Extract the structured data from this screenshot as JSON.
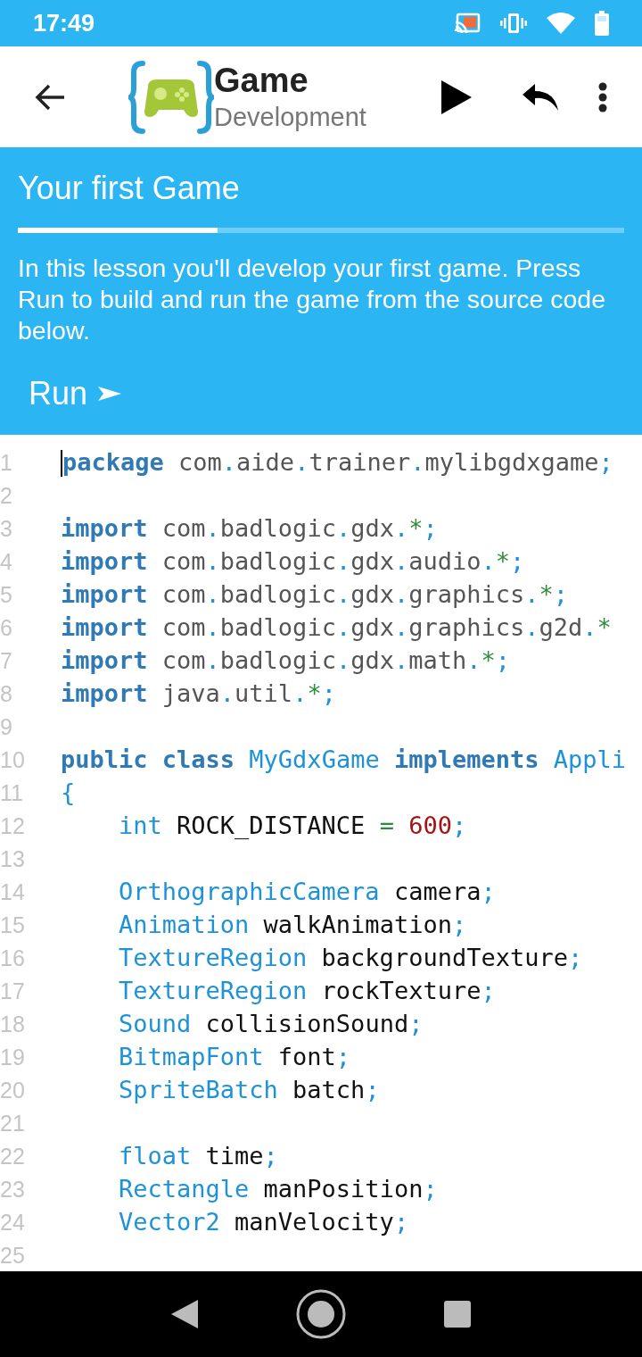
{
  "status_bar": {
    "time": "17:49"
  },
  "app_bar": {
    "title": "Game",
    "subtitle": "Development"
  },
  "lesson": {
    "title": "Your first Game",
    "progress": {
      "level": 0.33
    },
    "description": "In this lesson you'll develop your first game. Press Run to build and run the game from the source code below.",
    "run_button": "Run"
  },
  "editor": {
    "lines": [
      {
        "number": "1",
        "cursor": true,
        "tokens": [
          {
            "kind": "keyword",
            "t": "package"
          },
          {
            "kind": "package",
            "t": " com"
          },
          {
            "kind": "punct",
            "t": "."
          },
          {
            "kind": "package",
            "t": "aide"
          },
          {
            "kind": "punct",
            "t": "."
          },
          {
            "kind": "package",
            "t": "trainer"
          },
          {
            "kind": "punct",
            "t": "."
          },
          {
            "kind": "package",
            "t": "mylibgdxgame"
          },
          {
            "kind": "punct",
            "t": ";"
          }
        ]
      },
      {
        "number": "2",
        "cursor": false
      },
      {
        "number": "3",
        "cursor": false,
        "tokens": [
          {
            "kind": "keyword",
            "t": "import"
          },
          {
            "kind": "package",
            "t": " com"
          },
          {
            "kind": "punct",
            "t": "."
          },
          {
            "kind": "package",
            "t": "badlogic"
          },
          {
            "kind": "punct",
            "t": "."
          },
          {
            "kind": "package",
            "t": "gdx"
          },
          {
            "kind": "punct",
            "t": "."
          },
          {
            "kind": "operator",
            "t": "*"
          },
          {
            "kind": "punct",
            "t": ";"
          }
        ]
      },
      {
        "number": "4",
        "cursor": false,
        "tokens": [
          {
            "kind": "keyword",
            "t": "import"
          },
          {
            "kind": "package",
            "t": " com"
          },
          {
            "kind": "punct",
            "t": "."
          },
          {
            "kind": "package",
            "t": "badlogic"
          },
          {
            "kind": "punct",
            "t": "."
          },
          {
            "kind": "package",
            "t": "gdx"
          },
          {
            "kind": "punct",
            "t": "."
          },
          {
            "kind": "package",
            "t": "audio"
          },
          {
            "kind": "punct",
            "t": "."
          },
          {
            "kind": "operator",
            "t": "*"
          },
          {
            "kind": "punct",
            "t": ";"
          }
        ]
      },
      {
        "number": "5",
        "cursor": false,
        "tokens": [
          {
            "kind": "keyword",
            "t": "import"
          },
          {
            "kind": "package",
            "t": " com"
          },
          {
            "kind": "punct",
            "t": "."
          },
          {
            "kind": "package",
            "t": "badlogic"
          },
          {
            "kind": "punct",
            "t": "."
          },
          {
            "kind": "package",
            "t": "gdx"
          },
          {
            "kind": "punct",
            "t": "."
          },
          {
            "kind": "package",
            "t": "graphics"
          },
          {
            "kind": "punct",
            "t": "."
          },
          {
            "kind": "operator",
            "t": "*"
          },
          {
            "kind": "punct",
            "t": ";"
          }
        ]
      },
      {
        "number": "6",
        "cursor": false,
        "tokens": [
          {
            "kind": "keyword",
            "t": "import"
          },
          {
            "kind": "package",
            "t": " com"
          },
          {
            "kind": "punct",
            "t": "."
          },
          {
            "kind": "package",
            "t": "badlogic"
          },
          {
            "kind": "punct",
            "t": "."
          },
          {
            "kind": "package",
            "t": "gdx"
          },
          {
            "kind": "punct",
            "t": "."
          },
          {
            "kind": "package",
            "t": "graphics"
          },
          {
            "kind": "punct",
            "t": "."
          },
          {
            "kind": "package",
            "t": "g2d"
          },
          {
            "kind": "punct",
            "t": "."
          },
          {
            "kind": "operator",
            "t": "*"
          }
        ]
      },
      {
        "number": "7",
        "cursor": false,
        "tokens": [
          {
            "kind": "keyword",
            "t": "import"
          },
          {
            "kind": "package",
            "t": " com"
          },
          {
            "kind": "punct",
            "t": "."
          },
          {
            "kind": "package",
            "t": "badlogic"
          },
          {
            "kind": "punct",
            "t": "."
          },
          {
            "kind": "package",
            "t": "gdx"
          },
          {
            "kind": "punct",
            "t": "."
          },
          {
            "kind": "package",
            "t": "math"
          },
          {
            "kind": "punct",
            "t": "."
          },
          {
            "kind": "operator",
            "t": "*"
          },
          {
            "kind": "punct",
            "t": ";"
          }
        ]
      },
      {
        "number": "8",
        "cursor": false,
        "tokens": [
          {
            "kind": "keyword",
            "t": "import"
          },
          {
            "kind": "package",
            "t": " java"
          },
          {
            "kind": "punct",
            "t": "."
          },
          {
            "kind": "package",
            "t": "util"
          },
          {
            "kind": "punct",
            "t": "."
          },
          {
            "kind": "operator",
            "t": "*"
          },
          {
            "kind": "punct",
            "t": ";"
          }
        ]
      },
      {
        "number": "9",
        "cursor": false
      },
      {
        "number": "10",
        "cursor": false,
        "tokens": [
          {
            "kind": "keyword",
            "t": "public"
          },
          {
            "kind": "keyword",
            "t": " class"
          },
          {
            "kind": "type",
            "t": " MyGdxGame"
          },
          {
            "kind": "keyword",
            "t": " implements"
          },
          {
            "kind": "type",
            "t": " Appli"
          }
        ]
      },
      {
        "number": "11",
        "cursor": false,
        "tokens": [
          {
            "kind": "punct",
            "t": "{"
          }
        ]
      },
      {
        "number": "12",
        "cursor": false,
        "tokens": [
          {
            "kind": "type",
            "t": "    int"
          },
          {
            "kind": "ident",
            "t": " ROCK_DISTANCE "
          },
          {
            "kind": "operator",
            "t": "="
          },
          {
            "kind": "number",
            "t": " 600"
          },
          {
            "kind": "punct",
            "t": ";"
          }
        ]
      },
      {
        "number": "13",
        "cursor": false
      },
      {
        "number": "14",
        "cursor": false,
        "tokens": [
          {
            "kind": "type",
            "t": "    OrthographicCamera"
          },
          {
            "kind": "ident",
            "t": " camera"
          },
          {
            "kind": "punct",
            "t": ";"
          }
        ]
      },
      {
        "number": "15",
        "cursor": false,
        "tokens": [
          {
            "kind": "type",
            "t": "    Animation"
          },
          {
            "kind": "ident",
            "t": " walkAnimation"
          },
          {
            "kind": "punct",
            "t": ";"
          }
        ]
      },
      {
        "number": "16",
        "cursor": false,
        "tokens": [
          {
            "kind": "type",
            "t": "    TextureRegion"
          },
          {
            "kind": "ident",
            "t": " backgroundTexture"
          },
          {
            "kind": "punct",
            "t": ";"
          }
        ]
      },
      {
        "number": "17",
        "cursor": false,
        "tokens": [
          {
            "kind": "type",
            "t": "    TextureRegion"
          },
          {
            "kind": "ident",
            "t": " rockTexture"
          },
          {
            "kind": "punct",
            "t": ";"
          }
        ]
      },
      {
        "number": "18",
        "cursor": false,
        "tokens": [
          {
            "kind": "type",
            "t": "    Sound"
          },
          {
            "kind": "ident",
            "t": " collisionSound"
          },
          {
            "kind": "punct",
            "t": ";"
          }
        ]
      },
      {
        "number": "19",
        "cursor": false,
        "tokens": [
          {
            "kind": "type",
            "t": "    BitmapFont"
          },
          {
            "kind": "ident",
            "t": " font"
          },
          {
            "kind": "punct",
            "t": ";"
          }
        ]
      },
      {
        "number": "20",
        "cursor": false,
        "tokens": [
          {
            "kind": "type",
            "t": "    SpriteBatch"
          },
          {
            "kind": "ident",
            "t": " batch"
          },
          {
            "kind": "punct",
            "t": ";"
          }
        ]
      },
      {
        "number": "21",
        "cursor": false
      },
      {
        "number": "22",
        "cursor": false,
        "tokens": [
          {
            "kind": "type",
            "t": "    float"
          },
          {
            "kind": "ident",
            "t": " time"
          },
          {
            "kind": "punct",
            "t": ";"
          }
        ]
      },
      {
        "number": "23",
        "cursor": false,
        "tokens": [
          {
            "kind": "type",
            "t": "    Rectangle"
          },
          {
            "kind": "ident",
            "t": " manPosition"
          },
          {
            "kind": "punct",
            "t": ";"
          }
        ]
      },
      {
        "number": "24",
        "cursor": false,
        "tokens": [
          {
            "kind": "type",
            "t": "    Vector2"
          },
          {
            "kind": "ident",
            "t": " manVelocity"
          },
          {
            "kind": "punct",
            "t": ";"
          }
        ]
      },
      {
        "number": "25",
        "cursor": false
      }
    ]
  }
}
